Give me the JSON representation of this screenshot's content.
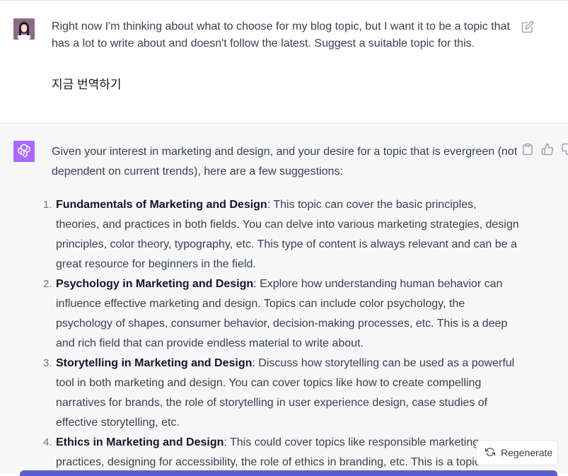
{
  "user_message": {
    "text": "Right now I'm thinking about what to choose for my blog topic, but I want it to be a topic that has a lot to write about and doesn't follow the latest. Suggest a suitable topic for this.",
    "translate_label": "지금 번역하기"
  },
  "assistant_message": {
    "intro": "Given your interest in marketing and design, and your desire for a topic that is evergreen (not dependent on current trends), here are a few suggestions:",
    "items": [
      {
        "number": "1.",
        "title": "Fundamentals of Marketing and Design",
        "body": ": This topic can cover the basic principles, theories, and practices in both fields. You can delve into various marketing strategies, design principles, color theory, typography, etc. This type of content is always relevant and can be a great resource for beginners in the field."
      },
      {
        "number": "2.",
        "title": "Psychology in Marketing and Design",
        "body": ": Explore how understanding human behavior can influence effective marketing and design. Topics can include color psychology, the psychology of shapes, consumer behavior, decision-making processes, etc. This is a deep and rich field that can provide endless material to write about."
      },
      {
        "number": "3.",
        "title": "Storytelling in Marketing and Design",
        "body": ": Discuss how storytelling can be used as a powerful tool in both marketing and design. You can cover topics like how to create compelling narratives for brands, the role of storytelling in user experience design, case studies of effective storytelling, etc."
      },
      {
        "number": "4.",
        "title": "Ethics in Marketing and Design",
        "body": ": This could cover topics like responsible marketing practices, designing for accessibility, the role of ethics in branding, etc. This is a topic"
      }
    ]
  },
  "regenerate_label": "Regenerate",
  "colors": {
    "assistant_bg": "#f7f7f8",
    "gpt_avatar": "#ab68ff",
    "bottom_bar": "#5a5fcf"
  },
  "icons": [
    "edit-icon",
    "openai-logo-icon",
    "copy-icon",
    "thumbs-up-icon",
    "thumbs-down-icon",
    "refresh-icon"
  ]
}
